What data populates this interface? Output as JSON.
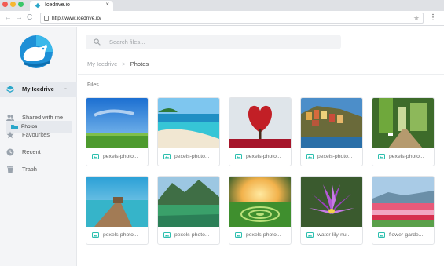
{
  "browser": {
    "tab_title": "Icedrive.io",
    "tab_close": "×",
    "url": "http://www.icedrive.io/",
    "back": "←",
    "forward": "→",
    "reload": "C",
    "star": "★",
    "menu": "⋮"
  },
  "sidebar": {
    "items": [
      {
        "label": "My Icedrive",
        "icon": "layers-icon",
        "active": true,
        "chevron": "⌄"
      },
      {
        "label": "Shared with me",
        "icon": "people-icon"
      },
      {
        "label": "Favourites",
        "icon": "star-icon"
      },
      {
        "label": "Recent",
        "icon": "clock-icon"
      },
      {
        "label": "Trash",
        "icon": "trash-icon"
      }
    ],
    "sub_item": {
      "label": "Photos",
      "icon": "folder-icon"
    }
  },
  "main": {
    "search_placeholder": "Search files...",
    "breadcrumb": {
      "root": "My Icedrive",
      "separator": ">",
      "current": "Photos"
    },
    "section_label": "Files",
    "files": [
      {
        "name": "pexels-photo..."
      },
      {
        "name": "pexels-photo..."
      },
      {
        "name": "pexels-photo..."
      },
      {
        "name": "pexels-photo..."
      },
      {
        "name": "pexels-photo..."
      },
      {
        "name": "pexels-photo..."
      },
      {
        "name": "pexels-photo..."
      },
      {
        "name": "pexels-photo..."
      },
      {
        "name": "water-lily-nu..."
      },
      {
        "name": "flower-garde..."
      }
    ]
  },
  "colors": {
    "accent": "#2bbfae",
    "sidebar_icon": "#9aa3ad",
    "active_icon": "#2aa6c9"
  }
}
